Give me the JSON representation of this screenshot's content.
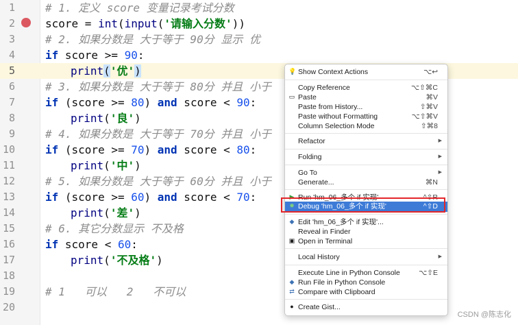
{
  "editor": {
    "line_numbers": [
      "1",
      "2",
      "3",
      "4",
      "5",
      "6",
      "7",
      "8",
      "9",
      "10",
      "11",
      "12",
      "13",
      "14",
      "15",
      "16",
      "17",
      "18",
      "19",
      "20"
    ],
    "lines": {
      "l1_comment": "# 1. 定义 score 变量记录考试分数",
      "l2_a": "score = ",
      "l2_fn1": "int",
      "l2_b": "(",
      "l2_fn2": "input",
      "l2_c": "(",
      "l2_str": "'请输入分数'",
      "l2_d": "))",
      "l3_comment": "# 2. 如果分数是 大于等于 90分 显示 优",
      "l4_kw": "if",
      "l4_a": " score >= ",
      "l4_num": "90",
      "l4_b": ":",
      "l5_fn": "print",
      "l5_a": "(",
      "l5_str": "'优'",
      "l5_b": ")",
      "l6_comment": "# 3. 如果分数是 大于等于 80分 并且 小于",
      "l7_kw": "if",
      "l7_a": " (score >= ",
      "l7_num1": "80",
      "l7_b": ") ",
      "l7_kw2": "and",
      "l7_c": " score < ",
      "l7_num2": "90",
      "l7_d": ":",
      "l8_fn": "print",
      "l8_a": "(",
      "l8_str": "'良'",
      "l8_b": ")",
      "l9_comment": "# 4. 如果分数是 大于等于 70分 并且 小于",
      "l10_kw": "if",
      "l10_a": " (score >= ",
      "l10_num1": "70",
      "l10_b": ") ",
      "l10_kw2": "and",
      "l10_c": " score < ",
      "l10_num2": "80",
      "l10_d": ":",
      "l11_fn": "print",
      "l11_a": "(",
      "l11_str": "'中'",
      "l11_b": ")",
      "l12_comment": "# 5. 如果分数是 大于等于 60分 并且 小于",
      "l13_kw": "if",
      "l13_a": " (score >= ",
      "l13_num1": "60",
      "l13_b": ") ",
      "l13_kw2": "and",
      "l13_c": " score < ",
      "l13_num2": "70",
      "l13_d": ":",
      "l14_fn": "print",
      "l14_a": "(",
      "l14_str": "'差'",
      "l14_b": ")",
      "l15_comment": "# 6. 其它分数显示 不及格",
      "l16_kw": "if",
      "l16_a": " score < ",
      "l16_num": "60",
      "l16_b": ":",
      "l17_fn": "print",
      "l17_a": "(",
      "l17_str": "'不及格'",
      "l17_b": ")",
      "l19_comment": "# 1   可以   2   不可以"
    }
  },
  "context_menu": {
    "show_context_actions": {
      "label": "Show Context Actions",
      "shortcut": "⌥↩"
    },
    "copy_reference": {
      "label": "Copy Reference",
      "shortcut": "⌥⇧⌘C"
    },
    "paste": {
      "label": "Paste",
      "shortcut": "⌘V"
    },
    "paste_from_history": {
      "label": "Paste from History...",
      "shortcut": "⇧⌘V"
    },
    "paste_without_formatting": {
      "label": "Paste without Formatting",
      "shortcut": "⌥⇧⌘V"
    },
    "column_selection_mode": {
      "label": "Column Selection Mode",
      "shortcut": "⇧⌘8"
    },
    "refactor": {
      "label": "Refactor"
    },
    "folding": {
      "label": "Folding"
    },
    "go_to": {
      "label": "Go To"
    },
    "generate": {
      "label": "Generate...",
      "shortcut": "⌘N"
    },
    "run": {
      "label": "Run 'hm_06_多个 if 实现'",
      "shortcut": "^⇧R"
    },
    "debug": {
      "label": "Debug 'hm_06_多个 if 实现'",
      "shortcut": "^⇧D"
    },
    "edit_config": {
      "label": "Edit 'hm_06_多个 if 实现'..."
    },
    "reveal_in_finder": {
      "label": "Reveal in Finder"
    },
    "open_in_terminal": {
      "label": "Open in Terminal"
    },
    "local_history": {
      "label": "Local History"
    },
    "execute_line": {
      "label": "Execute Line in Python Console",
      "shortcut": "⌥⇧E"
    },
    "run_file_console": {
      "label": "Run File in Python Console"
    },
    "compare_clipboard": {
      "label": "Compare with Clipboard"
    },
    "create_gist": {
      "label": "Create Gist..."
    }
  },
  "watermark": "CSDN @陈志化",
  "colors": {
    "selected_item": "#3d7bd7",
    "highlight_box": "#e3262a",
    "breakpoint": "#db5860",
    "current_line": "#fcf7de"
  }
}
